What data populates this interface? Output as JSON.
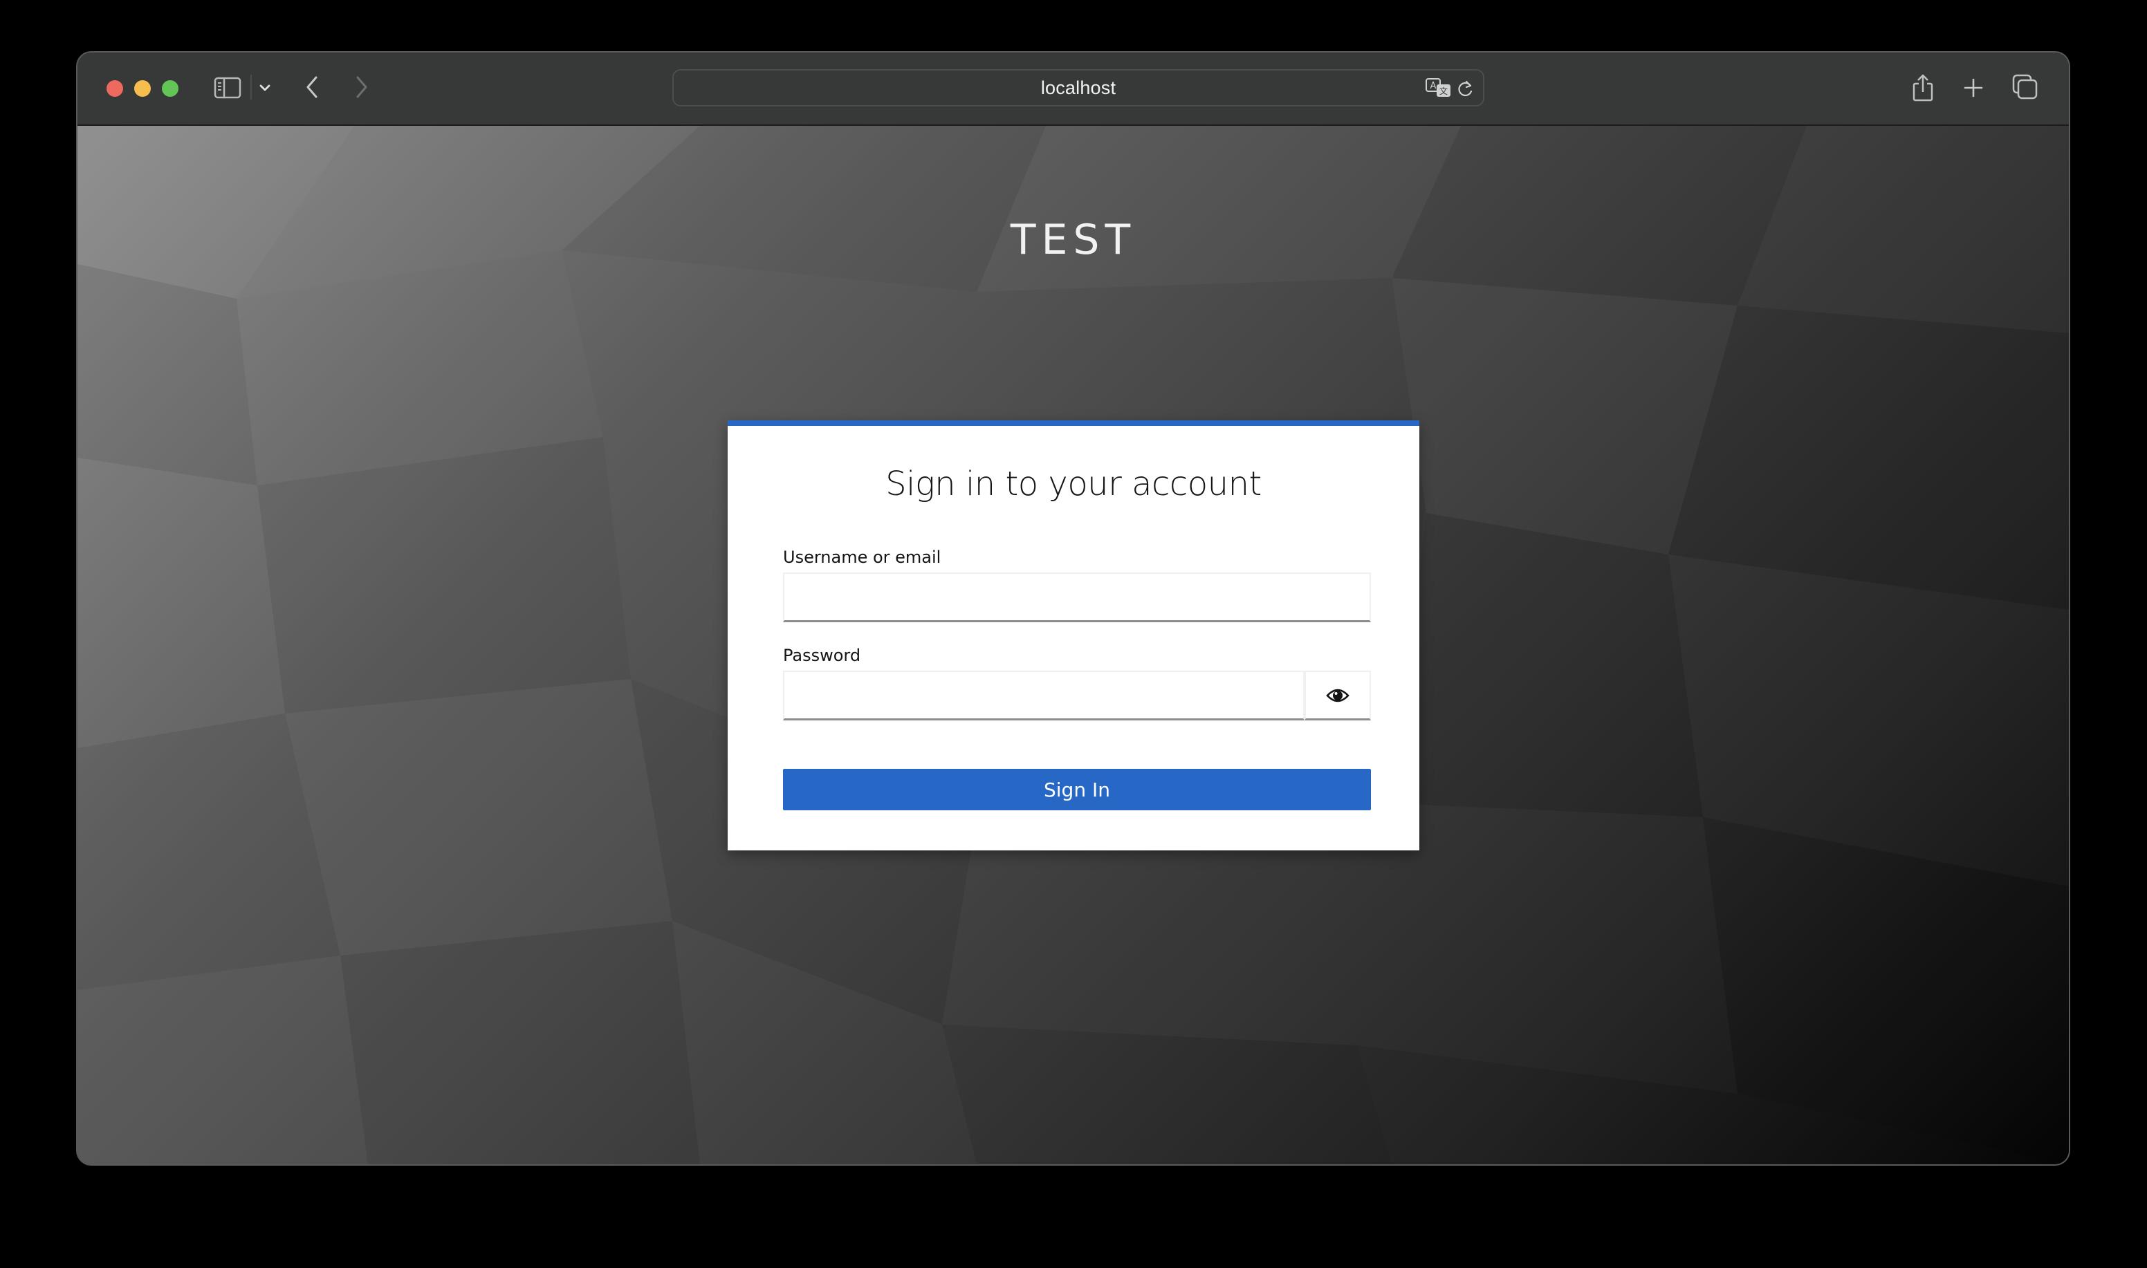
{
  "browser": {
    "address": "localhost",
    "icons": {
      "sidebar": "sidebar-icon",
      "sidebar_menu": "chevron-down-icon",
      "back": "chevron-left-icon",
      "forward": "chevron-right-icon",
      "translate": "translate-icon",
      "reload": "reload-icon",
      "share": "share-icon",
      "new_tab": "plus-icon",
      "tab_overview": "tabs-icon"
    }
  },
  "page": {
    "realm_title": "TEST",
    "card": {
      "heading": "Sign in to your account",
      "username": {
        "label": "Username or email",
        "value": "",
        "placeholder": ""
      },
      "password": {
        "label": "Password",
        "value": "",
        "placeholder": "",
        "toggle_icon": "eye-icon"
      },
      "submit_label": "Sign In"
    }
  },
  "colors": {
    "accent": "#2767c6",
    "toolbar": "#373838",
    "close": "#ee6a5f",
    "minimize": "#f5be4f",
    "maximize": "#62c555"
  }
}
